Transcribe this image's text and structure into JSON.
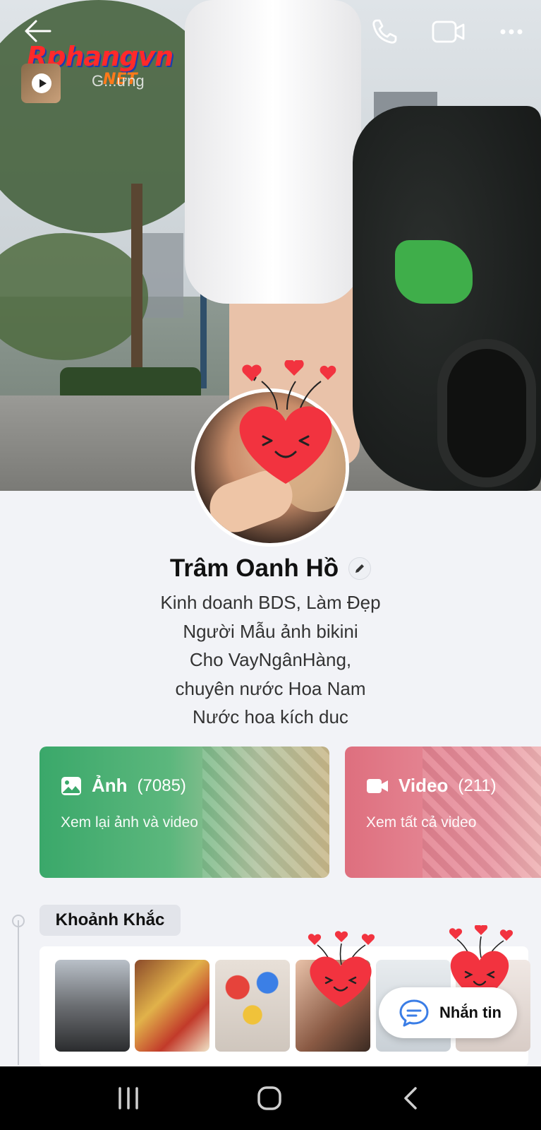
{
  "header": {
    "watermark_logo": "Rphangvn",
    "watermark_suffix": "NET",
    "story_label": "G...ưng"
  },
  "profile": {
    "name": "Trâm Oanh Hồ",
    "bio_lines": [
      "Kinh doanh BDS, Làm Đẹp",
      "Người Mẫu ảnh bikini",
      "Cho VayNgânHàng,",
      "chuyên nước Hoa Nam",
      "Nước hoa kích duc"
    ]
  },
  "cards": {
    "photo": {
      "label": "Ảnh",
      "count": "(7085)",
      "subtitle": "Xem lại ảnh và video"
    },
    "video": {
      "label": "Video",
      "count": "(211)",
      "subtitle": "Xem tất cả video"
    }
  },
  "moments": {
    "title": "Khoảnh Khắc",
    "thumbnail_count": 6
  },
  "message_button": {
    "label": "Nhắn tin"
  },
  "colors": {
    "photo_card": "#3aa86a",
    "video_card": "#de6f7e",
    "heart": "#f2333f",
    "message_icon": "#3a7de6"
  },
  "icons": {
    "back": "arrow-left-icon",
    "call": "phone-icon",
    "video_call": "video-camera-icon",
    "more": "more-dots-icon",
    "edit": "pencil-icon",
    "photo": "image-icon",
    "video": "video-icon",
    "message": "chat-bubble-icon"
  }
}
